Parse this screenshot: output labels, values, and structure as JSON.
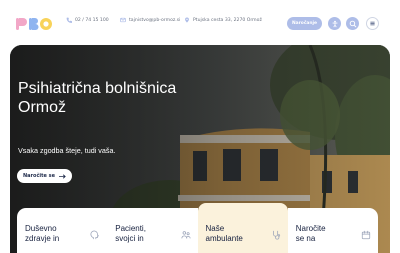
{
  "header": {
    "logo_text": "PBO",
    "phone": "02 / 74 15 100",
    "email": "tajnistvo@pb-ormoz.si",
    "address": "Ptujska cesta 33, 2270 Ormož",
    "cta_label": "Naročanje",
    "icons": [
      "accessibility-icon",
      "search-icon",
      "menu-icon"
    ]
  },
  "hero": {
    "title_line1": "Psihiatrična bolnišnica",
    "title_line2": "Ormož",
    "subtitle": "Vsaka zgodba šteje, tudi vaša.",
    "button_label": "Naročite se"
  },
  "cards": [
    {
      "line1": "Duševno",
      "line2": "zdravje in",
      "icon": "head-icon"
    },
    {
      "line1": "Pacienti,",
      "line2": "svojci in",
      "icon": "people-icon"
    },
    {
      "line1": "Naše",
      "line2": "ambulante",
      "icon": "stethoscope-icon"
    },
    {
      "line1": "Naročite",
      "line2": "se na",
      "icon": "calendar-icon"
    }
  ],
  "colors": {
    "accent": "#aebde8",
    "navy": "#17213f",
    "active_card": "#fbf2dc",
    "logo_pink": "#f2a7c7",
    "logo_blue": "#8fb4f0",
    "logo_yellow": "#f8d35a"
  }
}
